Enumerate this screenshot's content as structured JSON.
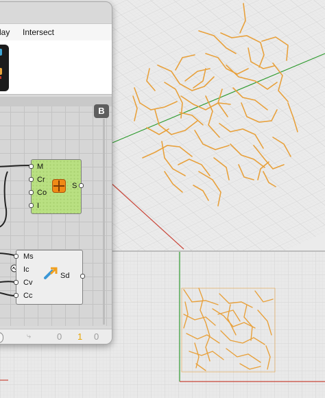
{
  "menu": {
    "item1": "lay",
    "item2": "Intersect"
  },
  "canvas_badge": "B",
  "component_top": {
    "inputs": [
      "M",
      "Cr",
      "Co",
      "I"
    ],
    "outputs": [
      "S"
    ],
    "icon": "orange-grid-icon",
    "color": "#b9e082"
  },
  "component_bottom": {
    "inputs": [
      "Ms",
      "Ic",
      "Cv",
      "Cc"
    ],
    "outputs": [
      "Sd"
    ],
    "icon": "split-arrow-icon",
    "color": "#eeeeee"
  },
  "status": {
    "n0": "0",
    "n1": "1",
    "n2": "0",
    "highlight": "#e8a400"
  },
  "viewport": {
    "curve_color": "#e8a13c",
    "axis_x_color": "#d23a2a",
    "axis_y_color": "#2d9a2d"
  }
}
